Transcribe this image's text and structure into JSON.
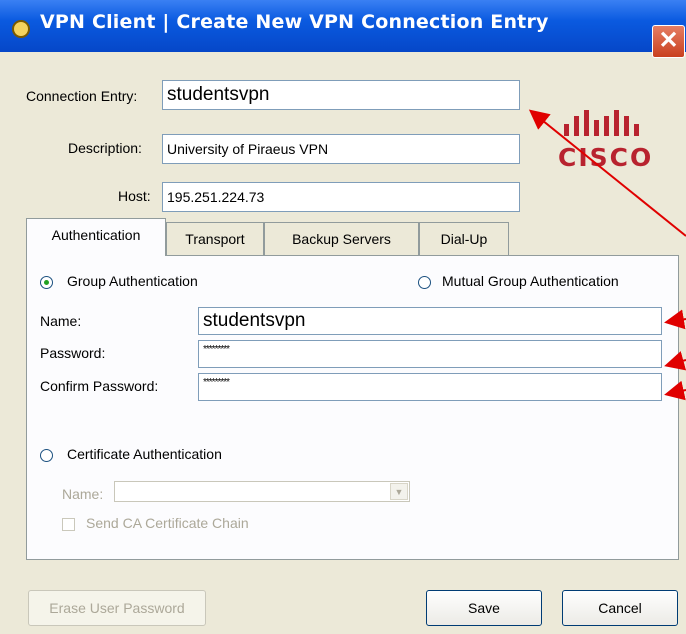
{
  "window": {
    "title": "VPN Client  |  Create New VPN Connection Entry",
    "close_label": "✕"
  },
  "form": {
    "connection_entry_label": "Connection Entry:",
    "connection_entry_value": "studentsvpn",
    "description_label": "Description:",
    "description_value": "University of Piraeus VPN",
    "host_label": "Host:",
    "host_value": "195.251.224.73"
  },
  "logo": {
    "word": "CISCO",
    "color": "#b8232f"
  },
  "tabs": [
    {
      "label": "Authentication",
      "active": true
    },
    {
      "label": "Transport"
    },
    {
      "label": "Backup Servers"
    },
    {
      "label": "Dial-Up"
    }
  ],
  "auth": {
    "group_label": "Group Authentication",
    "mutual_label": "Mutual Group Authentication",
    "name_label": "Name:",
    "name_value": "studentsvpn",
    "password_label": "Password:",
    "password_value": "*********",
    "confirm_label": "Confirm Password:",
    "confirm_value": "*********",
    "cert_label": "Certificate Authentication",
    "cert_name_label": "Name:",
    "send_ca_label": "Send CA Certificate Chain"
  },
  "buttons": {
    "erase": "Erase User Password",
    "save": "Save",
    "cancel": "Cancel"
  },
  "annotation_color": "#e00000"
}
